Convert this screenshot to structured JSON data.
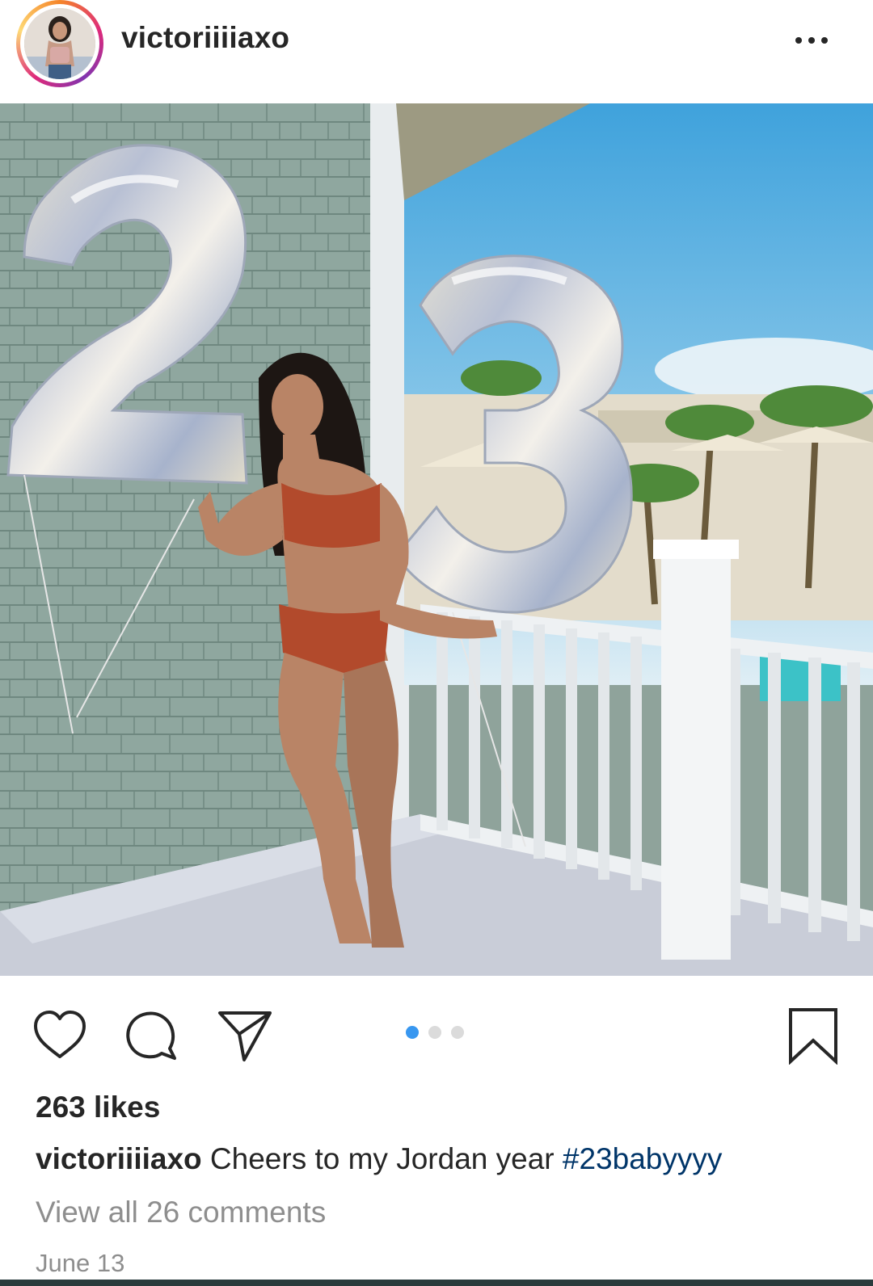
{
  "post": {
    "username": "victoriiiiaxo",
    "avatar_icon": "profile-photo",
    "more_icon": "more-options-icon"
  },
  "actions": {
    "like_icon": "heart-icon",
    "comment_icon": "comment-icon",
    "share_icon": "paper-plane-icon",
    "save_icon": "bookmark-icon"
  },
  "carousel": {
    "total": 3,
    "active_index": 0,
    "active_color": "#3897f0",
    "inactive_color": "#dbdbdb"
  },
  "likes_text": "263 likes",
  "caption": {
    "username": "victoriiiiaxo",
    "text": " Cheers to my Jordan year ",
    "hashtag": "#23babyyyy",
    "hashtag_color": "#003569"
  },
  "view_comments": "View all 26 comments",
  "date": "June 13"
}
